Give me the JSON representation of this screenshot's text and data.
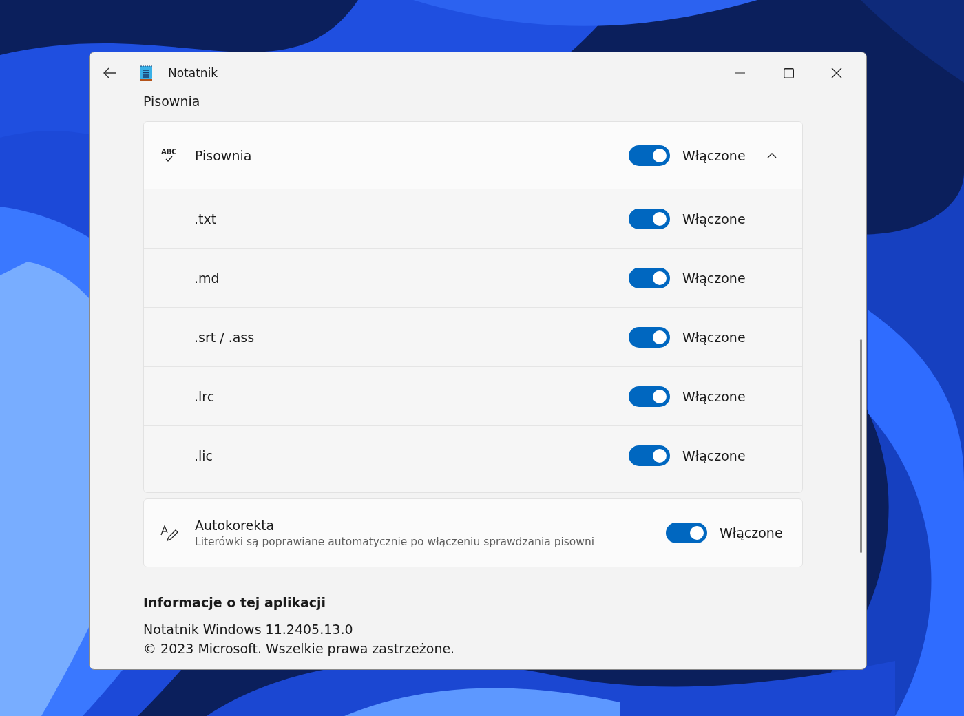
{
  "window": {
    "title": "Notatnik"
  },
  "section_title": "Pisownia",
  "spelling": {
    "icon_text": "ABC",
    "label": "Pisownia",
    "on": true,
    "state_text": "Włączone",
    "expanded": true,
    "file_types": [
      {
        "label": ".txt",
        "on": true,
        "state_text": "Włączone"
      },
      {
        "label": ".md",
        "on": true,
        "state_text": "Włączone"
      },
      {
        "label": ".srt / .ass",
        "on": true,
        "state_text": "Włączone"
      },
      {
        "label": ".lrc",
        "on": true,
        "state_text": "Włączone"
      },
      {
        "label": ".lic",
        "on": true,
        "state_text": "Włączone"
      }
    ]
  },
  "autocorrect": {
    "label": "Autokorekta",
    "description": "Literówki są poprawiane automatycznie po włączeniu sprawdzania pisowni",
    "on": true,
    "state_text": "Włączone"
  },
  "about": {
    "heading": "Informacje o tej aplikacji",
    "version": "Notatnik Windows 11.2405.13.0",
    "copyright": "© 2023 Microsoft. Wszelkie prawa zastrzeżone."
  }
}
